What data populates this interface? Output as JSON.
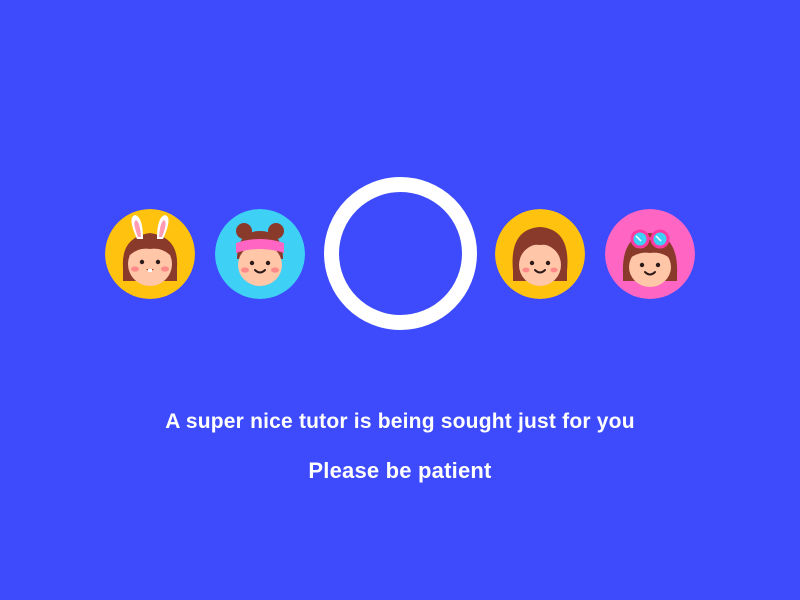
{
  "screen": {
    "background_color": "#3d4bfc"
  },
  "avatars": [
    {
      "name": "tutor-bunny-ears",
      "bg_color": "#ffc20e",
      "icon": "girl-with-bunny-ears-icon"
    },
    {
      "name": "tutor-pink-cap",
      "bg_color": "#3fd0f5",
      "icon": "girl-with-pink-headband-icon"
    },
    {
      "name": "tutor-brown-hair",
      "bg_color": "#ffc20e",
      "icon": "girl-with-brown-hair-icon"
    },
    {
      "name": "tutor-sunglasses",
      "bg_color": "#ff66c4",
      "icon": "girl-with-sunglasses-icon"
    }
  ],
  "loader": {
    "icon": "search-ring-icon",
    "color": "#ffffff"
  },
  "message": {
    "main": "A super nice tutor is being sought just for you",
    "sub": "Please be patient"
  }
}
